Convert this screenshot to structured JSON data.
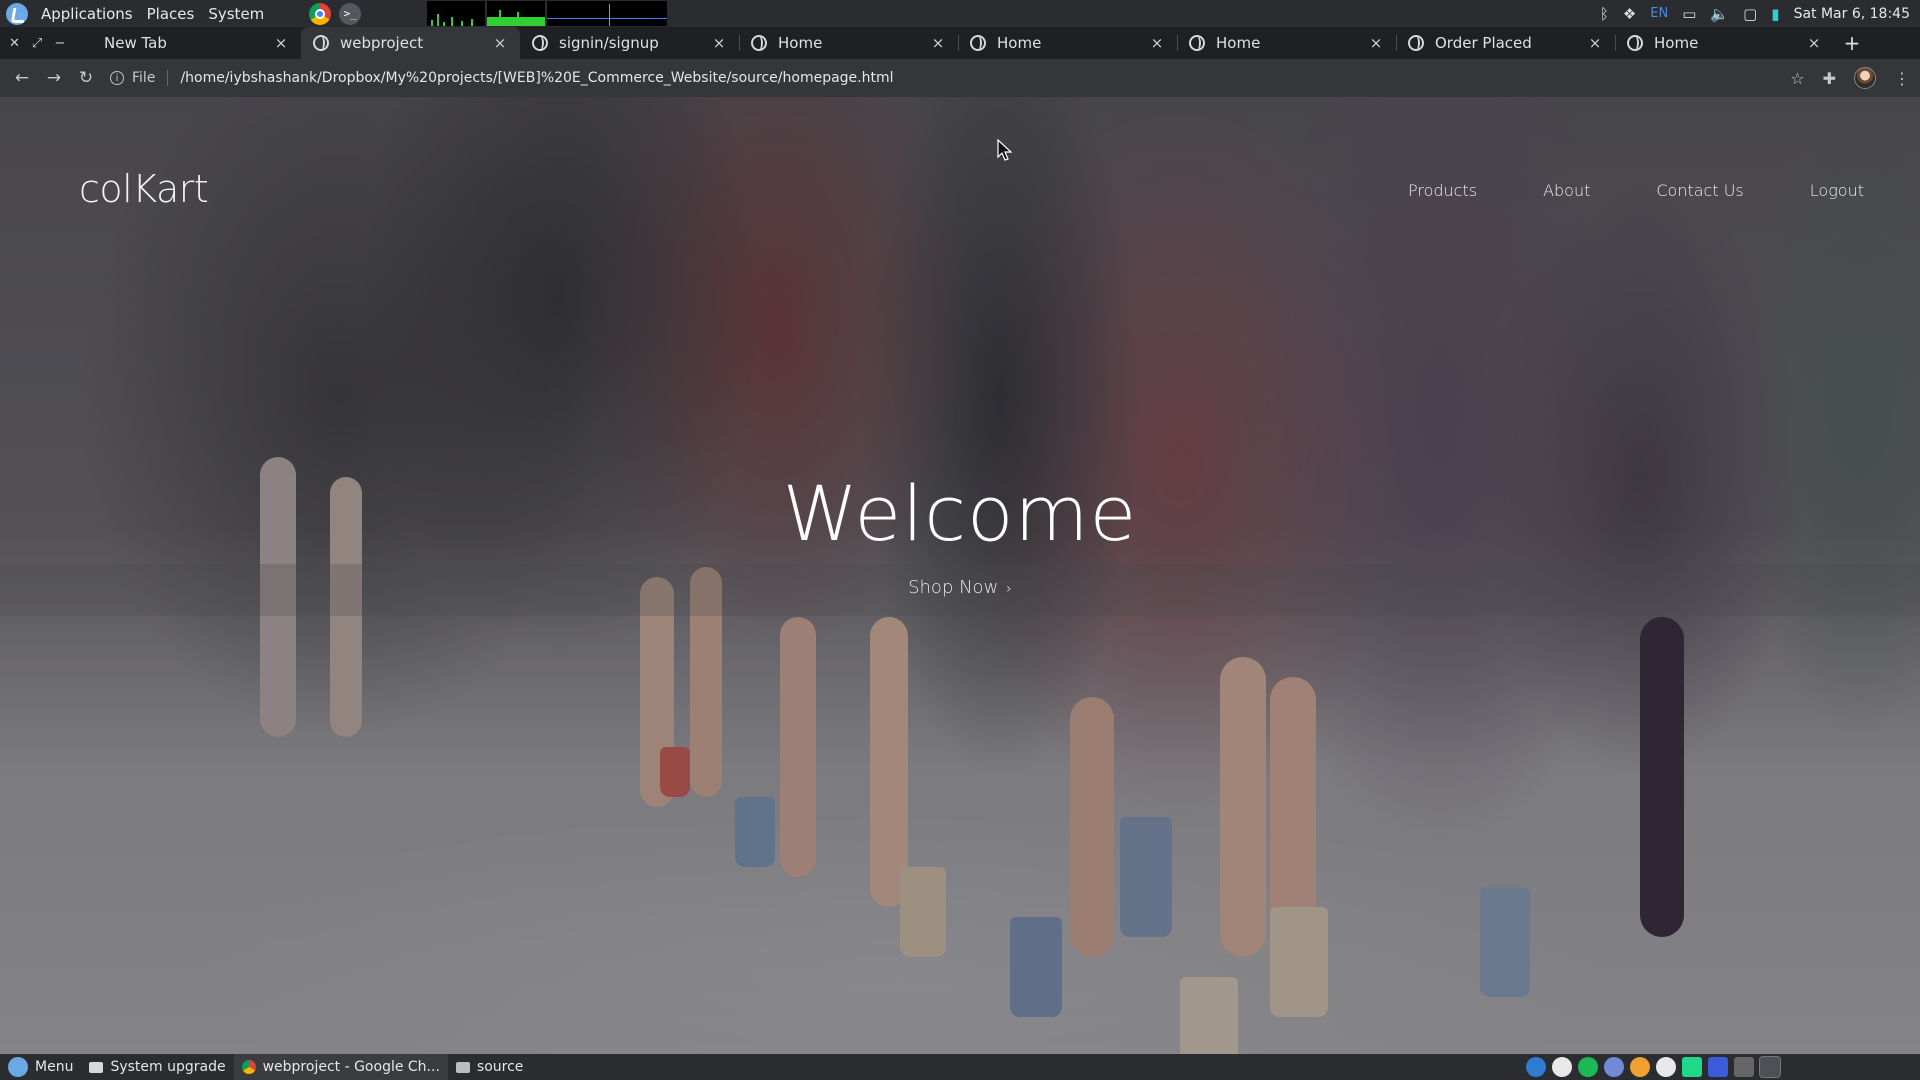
{
  "system_panel": {
    "menus": [
      "Applications",
      "Places",
      "System"
    ],
    "clock": "Sat Mar  6, 18:45",
    "keyboard_layout": "EN",
    "icons": [
      "bluetooth-icon",
      "dropbox-icon",
      "display-icon",
      "volume-icon",
      "screen-icon",
      "battery-icon"
    ]
  },
  "browser": {
    "tabs": [
      {
        "title": "New Tab",
        "has_favicon": false
      },
      {
        "title": "webproject",
        "has_favicon": true,
        "active": true
      },
      {
        "title": "signin/signup",
        "has_favicon": true
      },
      {
        "title": "Home",
        "has_favicon": true
      },
      {
        "title": "Home",
        "has_favicon": true
      },
      {
        "title": "Home",
        "has_favicon": true
      },
      {
        "title": "Order Placed",
        "has_favicon": true
      },
      {
        "title": "Home",
        "has_favicon": true
      }
    ],
    "close_glyph": "×",
    "new_tab_glyph": "+",
    "address": {
      "scheme_label": "File",
      "url": "/home/iybshashank/Dropbox/My%20projects/[WEB]%20E_Commerce_Website/source/homepage.html"
    }
  },
  "site": {
    "brand": "colKart",
    "nav": [
      "Products",
      "About",
      "Contact Us",
      "Logout"
    ],
    "hero_title": "Welcome",
    "cta": "Shop Now",
    "cta_chevron": "›"
  },
  "taskbar": {
    "menu_label": "Menu",
    "items": [
      {
        "label": "System upgrade",
        "icon": "window-icon"
      },
      {
        "label": "webproject - Google Ch...",
        "icon": "chrome-icon",
        "active": true
      },
      {
        "label": "source",
        "icon": "folder-icon"
      }
    ],
    "tray_colors": [
      "#2e7bcf",
      "#e8e8e8",
      "#1db954",
      "#7289da",
      "#f0a030",
      "#e8e8e8",
      "#21d789",
      "#3b5bdb",
      "#666666",
      "#4f5055"
    ]
  }
}
